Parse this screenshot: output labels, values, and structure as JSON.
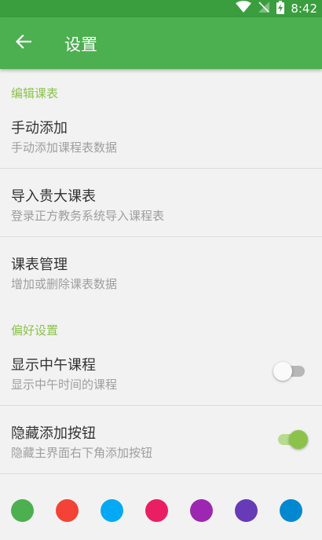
{
  "status_bar": {
    "time": "8:42"
  },
  "app_bar": {
    "title": "设置"
  },
  "sections": {
    "edit": "编辑课表",
    "prefs": "偏好设置"
  },
  "items": [
    {
      "title": "手动添加",
      "subtitle": "手动添加课程表数据"
    },
    {
      "title": "导入贵大课表",
      "subtitle": "登录正方教务系统导入课程表"
    },
    {
      "title": "课表管理",
      "subtitle": "增加或删除课表数据"
    },
    {
      "title": "显示中午课程",
      "subtitle": "显示中午时间的课程",
      "switch_on": false
    },
    {
      "title": "隐藏添加按钮",
      "subtitle": "隐藏主界面右下角添加按钮",
      "switch_on": true
    }
  ],
  "theme_colors": [
    "#4caf50",
    "#f44336",
    "#03a9f4",
    "#e91e63",
    "#9c27b0",
    "#673ab7",
    "#0288d1"
  ]
}
